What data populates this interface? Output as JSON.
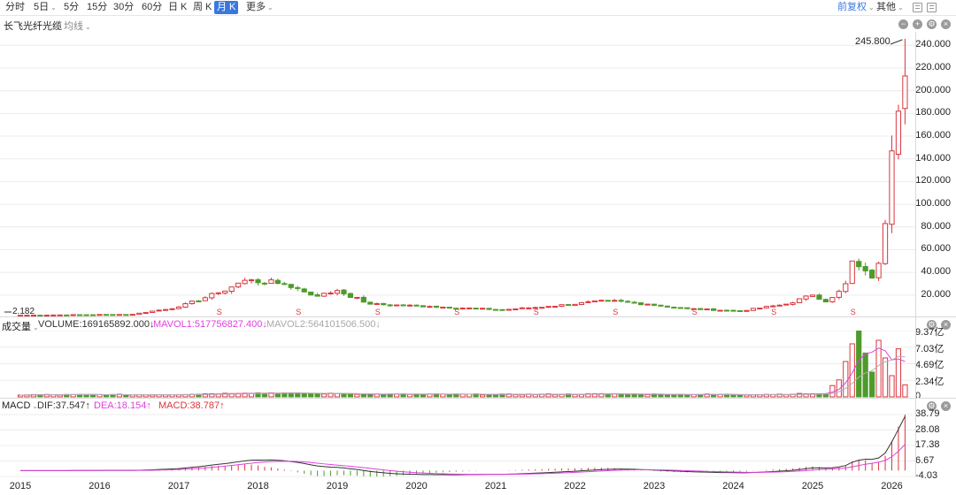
{
  "toolbar": {
    "timeframes": [
      {
        "label": "分时",
        "dropdown": false,
        "active": false
      },
      {
        "label": "5日",
        "dropdown": true,
        "active": false
      },
      {
        "label": "5分",
        "dropdown": false,
        "active": false
      },
      {
        "label": "15分",
        "dropdown": false,
        "active": false
      },
      {
        "label": "30分",
        "dropdown": false,
        "active": false
      },
      {
        "label": "60分",
        "dropdown": false,
        "active": false
      },
      {
        "label": "日 K",
        "dropdown": false,
        "active": false
      },
      {
        "label": "周 K",
        "dropdown": false,
        "active": false
      },
      {
        "label": "月 K",
        "dropdown": false,
        "active": true
      },
      {
        "label": "更多",
        "dropdown": true,
        "active": false
      }
    ],
    "adjust_label": "前复权",
    "other_label": "其他",
    "icons": [
      "table-icon",
      "grid-icon"
    ]
  },
  "main_panel": {
    "stock_name": "长飞光纤光缆",
    "indicator": "均线",
    "buttons": [
      "minimize-icon",
      "add-icon",
      "settings-icon",
      "close-icon"
    ],
    "high_label": "245.800",
    "low_label": "2.182",
    "dividend_marker": "S",
    "y_ticks": [
      "240.000",
      "220.000",
      "200.000",
      "180.000",
      "160.000",
      "140.000",
      "120.000",
      "100.000",
      "80.000",
      "60.000",
      "40.000",
      "20.000"
    ]
  },
  "volume_panel": {
    "title": "成交量",
    "volume_text": "VOLUME:169165892.000↓",
    "mavol1_text": "MAVOL1:517756827.400↓",
    "mavol2_text": "MAVOL2:564101506.500↓",
    "y_ticks": [
      "9.37亿",
      "7.03亿",
      "4.69亿",
      "2.34亿",
      "0"
    ]
  },
  "macd_panel": {
    "title": "MACD",
    "dif_text": "DIF:37.547↑",
    "dea_text": "DEA:18.154↑",
    "macd_text": "MACD:38.787↑",
    "y_ticks": [
      "38.79",
      "28.08",
      "17.38",
      "6.67",
      "-4.03"
    ]
  },
  "x_axis": [
    "2015",
    "2016",
    "2017",
    "2018",
    "2019",
    "2020",
    "2021",
    "2022",
    "2023",
    "2024",
    "2025",
    "2026"
  ],
  "colors": {
    "up": "#d9363e",
    "down": "#4e9a2b",
    "mavol1": "#e040e0",
    "mavol2": "#b0b0b0",
    "dif": "#333333",
    "dea": "#e040e0",
    "active_tab": "#3a78e0"
  },
  "chart_data": [
    {
      "type": "candlestick",
      "title": "长飞光纤光缆 月K",
      "price_ylim": [
        0,
        250
      ],
      "anchors": [
        {
          "x": "2015-01",
          "close": 2.2
        },
        {
          "x": "2016-06",
          "close": 3.0
        },
        {
          "x": "2017-01",
          "close": 9.5
        },
        {
          "x": "2017-07",
          "close": 22.0
        },
        {
          "x": "2017-11",
          "close": 33.0
        },
        {
          "x": "2018-05",
          "close": 30.0
        },
        {
          "x": "2018-10",
          "close": 19.0
        },
        {
          "x": "2019-01",
          "close": 24.0
        },
        {
          "x": "2019-06",
          "close": 12.0
        },
        {
          "x": "2020-03",
          "close": 10.0
        },
        {
          "x": "2021-02",
          "close": 7.0
        },
        {
          "x": "2021-09",
          "close": 10.0
        },
        {
          "x": "2022-06",
          "close": 15.0
        },
        {
          "x": "2022-12",
          "close": 12.0
        },
        {
          "x": "2023-06",
          "close": 8.0
        },
        {
          "x": "2024-02",
          "close": 6.0
        },
        {
          "x": "2024-09",
          "close": 12.0
        },
        {
          "x": "2025-01",
          "close": 20.0
        },
        {
          "x": "2025-03",
          "close": 14.0
        },
        {
          "x": "2025-06",
          "close": 30.0
        },
        {
          "x": "2025-07",
          "close": 50.0
        },
        {
          "x": "2025-08",
          "close": 45.0
        },
        {
          "x": "2025-10",
          "close": 35.0
        },
        {
          "x": "2025-11",
          "close": 48.0
        },
        {
          "x": "2025-12",
          "close": 83.0
        },
        {
          "x": "2026-01",
          "close": 147.0
        },
        {
          "x": "2026-02",
          "close": 182.0
        },
        {
          "x": "2026-03",
          "close": 213.0
        }
      ],
      "high": 245.8,
      "low": 2.182,
      "volume_ylim_yi": [
        0,
        9.37
      ],
      "recent_volumes_yi": [
        1.6,
        2.4,
        5.0,
        7.5,
        9.37,
        6.2,
        3.5,
        8.0,
        5.5,
        3.0,
        6.8,
        1.7
      ],
      "macd_ylim": [
        -4.03,
        38.79
      ],
      "macd_latest": {
        "dif": 37.547,
        "dea": 18.154,
        "macd": 38.787
      }
    }
  ]
}
